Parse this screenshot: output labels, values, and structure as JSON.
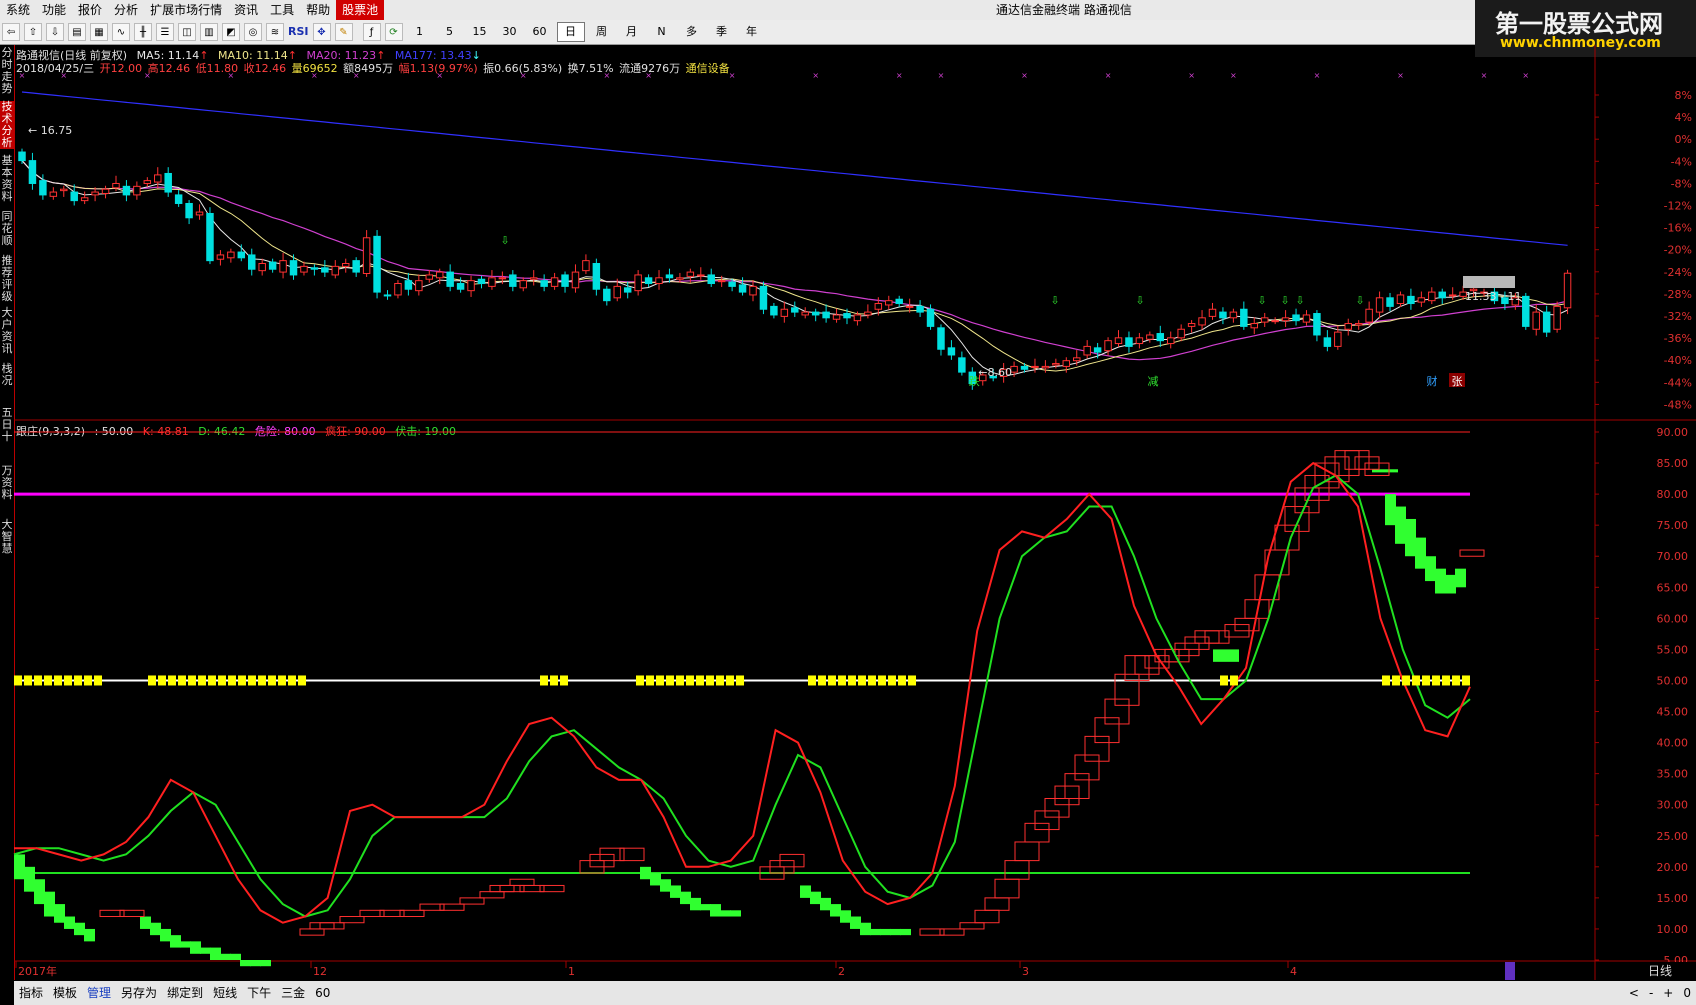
{
  "menu": {
    "items": [
      "系统",
      "功能",
      "报价",
      "分析",
      "扩展市场行情",
      "资讯",
      "工具",
      "帮助",
      "股票池"
    ],
    "active_index": 8
  },
  "app_title": "通达信金融终端   路通视信",
  "logo": {
    "line1": "第一股票公式网",
    "line2": "www.chnmoney.com"
  },
  "toolbar": {
    "periods": [
      "1",
      "5",
      "15",
      "30",
      "60",
      "日",
      "周",
      "月",
      "N",
      "多",
      "季",
      "年"
    ],
    "selected_period": "日",
    "rsi_label": "RSI"
  },
  "left_tabs": [
    {
      "label": "分时走势",
      "selected": false
    },
    {
      "label": "技术分析",
      "selected": true
    },
    {
      "label": "基本资料",
      "selected": false
    },
    {
      "label": "同花顺",
      "selected": false
    },
    {
      "label": "推荐评级",
      "selected": false
    },
    {
      "label": "大户资讯",
      "selected": false
    },
    {
      "label": "栈况",
      "selected": false
    },
    {
      "label": "五日十",
      "selected": false
    },
    {
      "label": "万资料",
      "selected": false
    },
    {
      "label": "大智慧",
      "selected": false
    }
  ],
  "stock": {
    "header": "路通视信(日线 前复权)",
    "ma5": "MA5: 11.14",
    "ma10": "MA10: 11.14",
    "ma20": "MA20: 11.23",
    "ma177": "MA177: 13.43",
    "date": "2018/04/25/三",
    "open": "开12.00",
    "high": "高12.46",
    "low": "低11.80",
    "close": "收12.46",
    "volume": "量69652",
    "amount": "额8495万",
    "change": "幅1.13(9.97%)",
    "amplitude": "振0.66(5.83%)",
    "turnover": "换7.51%",
    "float": "流通9276万",
    "sector": "通信设备"
  },
  "price_labels": {
    "high": "16.75",
    "low": "8.60",
    "current": "11.33 - 11",
    "high_arrow": "←",
    "low_arrow": "←"
  },
  "price_markers": [
    "跌",
    "减",
    "财",
    "张"
  ],
  "pct_axis": [
    "8%",
    "4%",
    "0%",
    "-4%",
    "-8%",
    "-12%",
    "-16%",
    "-20%",
    "-24%",
    "-28%",
    "-32%",
    "-36%",
    "-40%",
    "-44%",
    "-48%"
  ],
  "indicator": {
    "header": "跟庄(9,3,3,2)",
    "value": ": 50.00",
    "k": "K: 48.81",
    "d": "D: 46.42",
    "danger": "危险: 80.00",
    "crazy": "疯狂: 90.00",
    "ambush": "伏击: 19.00",
    "axis": [
      "90.00",
      "85.00",
      "80.00",
      "75.00",
      "70.00",
      "65.00",
      "60.00",
      "55.00",
      "50.00",
      "45.00",
      "40.00",
      "35.00",
      "30.00",
      "25.00",
      "20.00",
      "15.00",
      "10.00",
      "5.00"
    ]
  },
  "time_axis": [
    "2017年",
    "12",
    "1",
    "2",
    "3",
    "4"
  ],
  "right_bottom_label": "日线",
  "right_bottom_controls": [
    "<",
    "-",
    "+",
    "0"
  ],
  "bottom_tabs": [
    "指标",
    "模板",
    "管理",
    "另存为",
    "绑定到",
    "短线",
    "下午",
    "三金",
    "60"
  ],
  "bottom_selected": "管理",
  "colors": {
    "up": "#ff3232",
    "down": "#00e0e0",
    "ma5": "#e8e8e8",
    "ma10": "#f0e68c",
    "ma20": "#d040d0",
    "ma177": "#3030ff",
    "k": "#ff2020",
    "d": "#20e020",
    "danger_line": "#ff00ff",
    "ambush_line": "#20e020",
    "mid_line": "#ffffff",
    "mark": "#ffff00",
    "sell_block": "#30ff30",
    "buy_block": "#ff3030"
  },
  "chart_data": [
    {
      "type": "candlestick",
      "title": "路通视信(日线 前复权)",
      "series": [
        {
          "name": "MA5",
          "color": "#e8e8e8"
        },
        {
          "name": "MA10",
          "color": "#f0e68c"
        },
        {
          "name": "MA20",
          "color": "#d040d0"
        },
        {
          "name": "MA177",
          "color": "#3030ff"
        }
      ],
      "x": [
        "2017-11-01",
        "2018-04-25"
      ],
      "ylim": [
        7.5,
        19.5
      ],
      "close": [
        16.4,
        15.6,
        15.2,
        15.3,
        15.4,
        15.0,
        15.1,
        15.3,
        15.4,
        15.6,
        15.2,
        15.5,
        15.7,
        15.9,
        15.3,
        14.9,
        14.4,
        14.6,
        12.9,
        13.1,
        13.2,
        13.0,
        12.6,
        12.8,
        12.6,
        12.9,
        12.4,
        12.7,
        12.6,
        12.5,
        12.7,
        12.8,
        12.5,
        13.7,
        11.8,
        11.7,
        12.1,
        11.9,
        12.2,
        12.4,
        12.5,
        12.0,
        11.9,
        12.2,
        12.1,
        12.3,
        12.3,
        12.0,
        12.2,
        12.3,
        12.0,
        12.3,
        12.0,
        12.5,
        12.9,
        11.9,
        11.5,
        12.0,
        11.8,
        12.4,
        12.1,
        12.3,
        12.3,
        12.3,
        12.5,
        12.4,
        12.1,
        12.2,
        12.0,
        11.8,
        12.0,
        11.2,
        11.0,
        11.2,
        11.1,
        11.1,
        11.0,
        10.9,
        11.0,
        10.9,
        11.0,
        11.1,
        11.4,
        11.5,
        11.4,
        11.3,
        11.1,
        10.6,
        9.8,
        9.6,
        9.0,
        8.6,
        8.9,
        8.8,
        9.1,
        9.2,
        9.1,
        9.2,
        9.2,
        9.3,
        9.4,
        9.5,
        9.9,
        9.7,
        10.1,
        10.2,
        9.9,
        10.2,
        10.3,
        10.1,
        10.2,
        10.5,
        10.7,
        10.9,
        11.2,
        10.9,
        11.1,
        10.6,
        10.7,
        10.9,
        10.8,
        10.9,
        10.8,
        11.0,
        10.3,
        9.9,
        10.4,
        10.7,
        10.7,
        11.2,
        11.6,
        11.3,
        11.7,
        11.4,
        11.6,
        11.8,
        11.6,
        11.7,
        11.8,
        11.9,
        11.8,
        11.5,
        11.4,
        11.6,
        10.6,
        11.1,
        10.4,
        11.3,
        12.46
      ]
    },
    {
      "type": "line",
      "title": "跟庄(9,3,3,2)",
      "series": [
        {
          "name": "K",
          "color": "#ff2020",
          "values": [
            23,
            23,
            22,
            21,
            22,
            24,
            28,
            34,
            32,
            25,
            18,
            13,
            11,
            12,
            15,
            29,
            30,
            28,
            28,
            28,
            28,
            30,
            37,
            43,
            44,
            41,
            36,
            34,
            34,
            28,
            20,
            20,
            21,
            25,
            42,
            40,
            32,
            21,
            16,
            14,
            15,
            19,
            33,
            58,
            71,
            74,
            73,
            76,
            80,
            76,
            62,
            54,
            49,
            43,
            47,
            52,
            70,
            82,
            85,
            83,
            78,
            60,
            50,
            42,
            41,
            49
          ]
        },
        {
          "name": "D",
          "color": "#20e020",
          "values": [
            22,
            23,
            23,
            22,
            21,
            22,
            25,
            29,
            32,
            30,
            24,
            18,
            14,
            12,
            13,
            18,
            25,
            28,
            28,
            28,
            28,
            28,
            31,
            37,
            41,
            42,
            39,
            36,
            34,
            31,
            25,
            21,
            20,
            21,
            30,
            38,
            36,
            28,
            20,
            16,
            15,
            17,
            24,
            42,
            60,
            70,
            73,
            74,
            78,
            78,
            70,
            60,
            53,
            47,
            47,
            50,
            60,
            73,
            81,
            83,
            80,
            68,
            55,
            46,
            44,
            47
          ]
        }
      ],
      "ylim": [
        5,
        90
      ],
      "reference_lines": [
        {
          "name": "危险",
          "value": 80
        },
        {
          "name": "疯狂",
          "value": 90
        },
        {
          "name": "伏击",
          "value": 19
        },
        {
          "name": "mid",
          "value": 50
        }
      ]
    }
  ]
}
